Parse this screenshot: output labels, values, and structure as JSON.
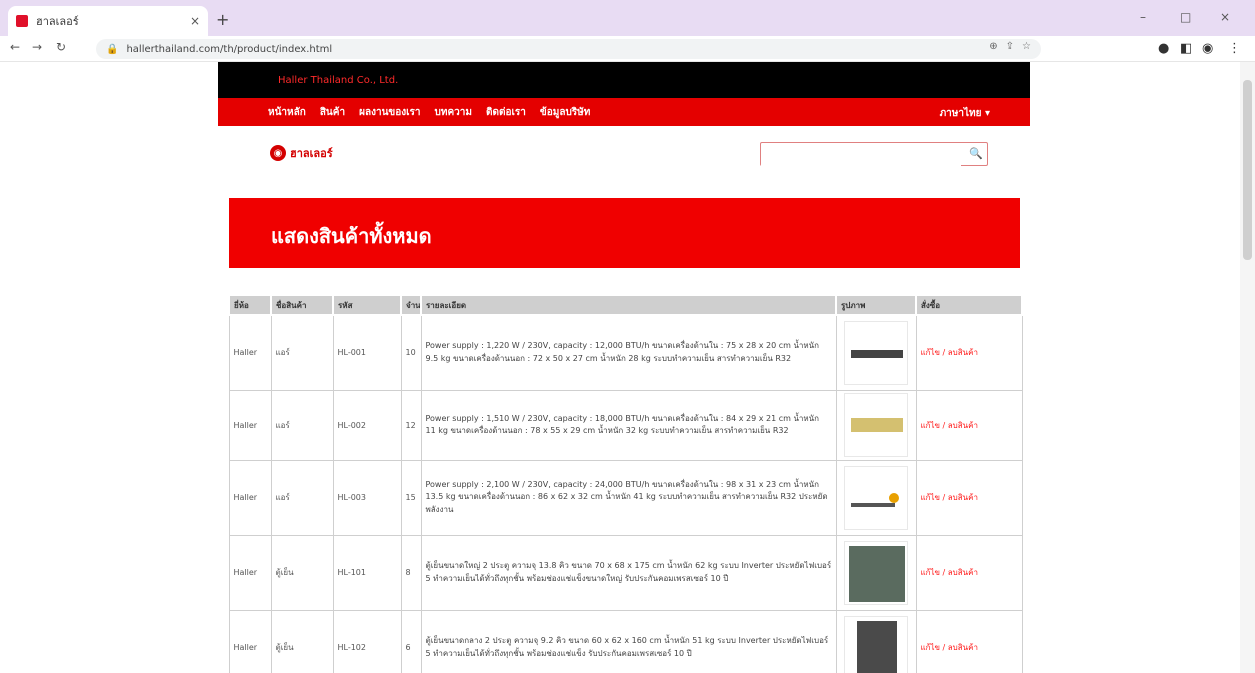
{
  "browser": {
    "tab_title": "ฮาลเลอร์",
    "tab_close": "×",
    "new_tab": "+",
    "url": "hallerthailand.com/th/product/index.html",
    "window_controls": [
      "–",
      "□",
      "×"
    ]
  },
  "site": {
    "top_strip_text": "Haller Thailand Co., Ltd.",
    "nav": [
      "หน้าหลัก",
      "สินค้า",
      "ผลงานของเรา",
      "บทความ",
      "ติดต่อเรา",
      "ข้อมูลบริษัท"
    ],
    "nav_right": "ภาษาไทย ▾",
    "logo_text": "ฮาลเลอร์",
    "search_placeholder": "",
    "banner_title": "แสดงสินค้าทั้งหมด",
    "table": {
      "headers": [
        "ยี่ห้อ",
        "ชื่อสินค้า",
        "รหัส",
        "จำนวน",
        "รายละเอียด",
        "รูปภาพ",
        "สั่งซื้อ"
      ],
      "rows": [
        {
          "brand": "Haller",
          "name": "แอร์",
          "code": "HL-001",
          "qty": "10",
          "detail": "Power supply : 1,220 W / 230V, capacity : 12,000 BTU/h ขนาดเครื่องด้านใน : 75 x 28 x 20 cm น้ำหนัก 9.5 kg ขนาดเครื่องด้านนอก : 72 x 50 x 27 cm น้ำหนัก 28 kg ระบบทำความเย็น สารทำความเย็น R32",
          "action": "แก้ไข / ลบสินค้า",
          "thumb_color": "#444444"
        },
        {
          "brand": "Haller",
          "name": "แอร์",
          "code": "HL-002",
          "qty": "12",
          "detail": "Power supply : 1,510 W / 230V, capacity : 18,000 BTU/h ขนาดเครื่องด้านใน : 84 x 29 x 21 cm น้ำหนัก 11 kg ขนาดเครื่องด้านนอก : 78 x 55 x 29 cm น้ำหนัก 32 kg ระบบทำความเย็น สารทำความเย็น R32",
          "action": "แก้ไข / ลบสินค้า",
          "thumb_color": "#d4c070"
        },
        {
          "brand": "Haller",
          "name": "แอร์",
          "code": "HL-003",
          "qty": "15",
          "detail": "Power supply : 2,100 W / 230V, capacity : 24,000 BTU/h ขนาดเครื่องด้านใน : 98 x 31 x 23 cm น้ำหนัก 13.5 kg ขนาดเครื่องด้านนอก : 86 x 62 x 32 cm น้ำหนัก 41 kg ระบบทำความเย็น สารทำความเย็น R32 ประหยัดพลังงาน",
          "action": "แก้ไข / ลบสินค้า",
          "thumb_color": "#e8a000"
        },
        {
          "brand": "Haller",
          "name": "ตู้เย็น",
          "code": "HL-101",
          "qty": "8",
          "detail": "ตู้เย็นขนาดใหญ่ 2 ประตู ความจุ 13.8 คิว ขนาด 70 x 68 x 175 cm น้ำหนัก 62 kg ระบบ Inverter ประหยัดไฟเบอร์ 5 ทำความเย็นได้ทั่วถึงทุกชั้น พร้อมช่องแช่แข็งขนาดใหญ่ รับประกันคอมเพรสเซอร์ 10 ปี",
          "action": "แก้ไข / ลบสินค้า",
          "thumb_color": "#5a6b5f"
        },
        {
          "brand": "Haller",
          "name": "ตู้เย็น",
          "code": "HL-102",
          "qty": "6",
          "detail": "ตู้เย็นขนาดกลาง 2 ประตู ความจุ 9.2 คิว ขนาด 60 x 62 x 160 cm น้ำหนัก 51 kg ระบบ Inverter ประหยัดไฟเบอร์ 5 ทำความเย็นได้ทั่วถึงทุกชั้น พร้อมช่องแช่แข็ง รับประกันคอมเพรสเซอร์ 10 ปี",
          "action": "แก้ไข / ลบสินค้า",
          "thumb_color": "#4a4a4a"
        }
      ]
    }
  }
}
